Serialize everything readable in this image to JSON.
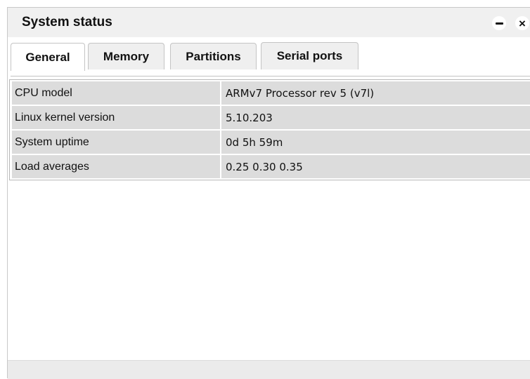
{
  "window": {
    "title": "System status"
  },
  "tabs": [
    {
      "label": "General",
      "active": true
    },
    {
      "label": "Memory",
      "active": false
    },
    {
      "label": "Partitions",
      "active": false
    },
    {
      "label": "Serial ports",
      "active": false
    }
  ],
  "general": {
    "rows": [
      {
        "label": "CPU model",
        "value": "ARMv7 Processor rev 5 (v7l)"
      },
      {
        "label": "Linux kernel version",
        "value": "5.10.203"
      },
      {
        "label": "System uptime",
        "value": "0d 5h 59m"
      },
      {
        "label": "Load averages",
        "value": "0.25 0.30 0.35"
      }
    ]
  },
  "icons": {
    "minimize": "minimize-icon",
    "close": "close-icon"
  },
  "colors": {
    "titlebar_bg": "#f0f0f0",
    "row_bg": "#dcdcdc",
    "inactive_tab_bg": "#efefef",
    "statusbar_bg": "#ebebeb"
  }
}
